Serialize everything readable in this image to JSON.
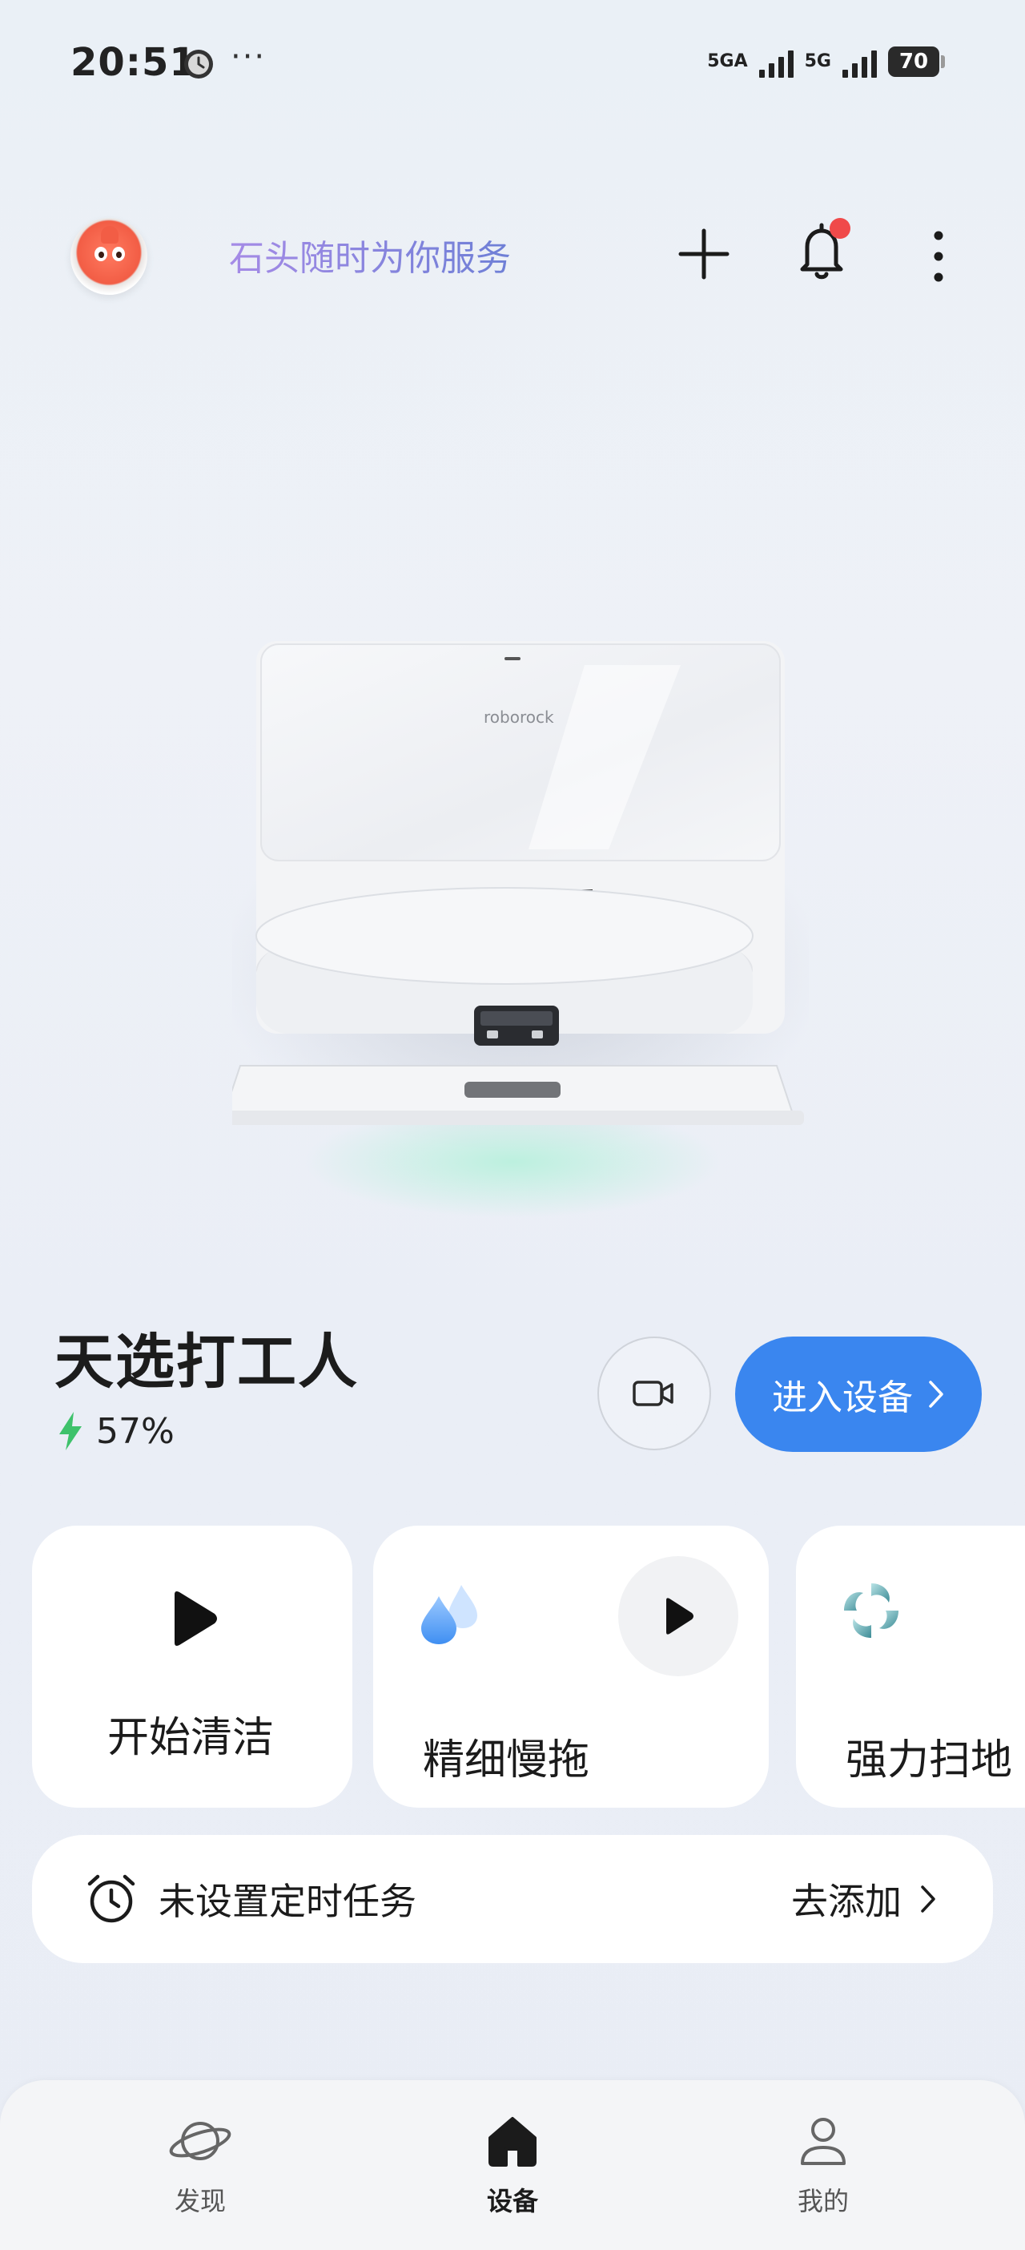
{
  "status_bar": {
    "time": "20:51",
    "dots": "···",
    "net1_label": "5GA",
    "net2_label": "5G",
    "battery": "70"
  },
  "header": {
    "greeting": "石头随时为你服务",
    "icons": [
      "avatar",
      "plus-icon",
      "bell-icon",
      "more-vertical-icon"
    ],
    "notification_dot_color": "#f04a4a"
  },
  "device": {
    "image_brand": "roborock",
    "name": "天选打工人",
    "battery": "57%",
    "enter_button": "进入设备",
    "accent_color": "#3a86ef"
  },
  "modes": [
    {
      "label": "开始清洁",
      "icon": "play-icon"
    },
    {
      "label": "精细慢拖",
      "icon": "water-drops-icon"
    },
    {
      "label": "强力扫地",
      "icon": "swirl-icon"
    }
  ],
  "schedule": {
    "text": "未设置定时任务",
    "action": "去添加"
  },
  "bottom_nav": [
    {
      "label": "发现",
      "icon": "planet-icon",
      "active": false
    },
    {
      "label": "设备",
      "icon": "home-icon",
      "active": true
    },
    {
      "label": "我的",
      "icon": "user-icon",
      "active": false
    }
  ]
}
